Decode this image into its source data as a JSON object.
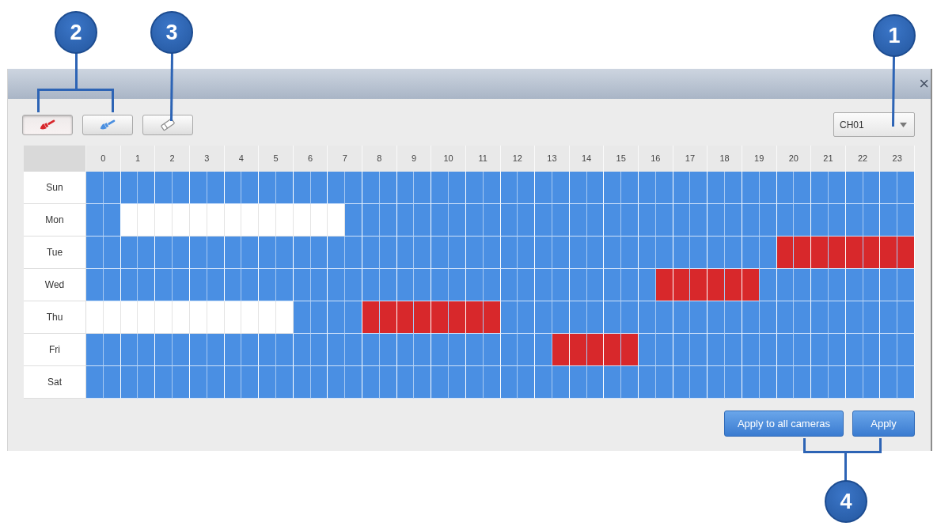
{
  "callouts": [
    {
      "label": "2"
    },
    {
      "label": "3"
    },
    {
      "label": "1"
    },
    {
      "label": "4"
    }
  ],
  "dialog": {
    "close": "×",
    "tools": [
      {
        "kind": "brush",
        "color": "#d8262b",
        "selected": true
      },
      {
        "kind": "brush",
        "color": "#4a8fe0",
        "selected": false
      },
      {
        "kind": "eraser",
        "selected": false
      }
    ],
    "channel": {
      "value": "CH01"
    },
    "schedule": {
      "hours": [
        "0",
        "1",
        "2",
        "3",
        "4",
        "5",
        "6",
        "7",
        "8",
        "9",
        "10",
        "11",
        "12",
        "13",
        "14",
        "15",
        "16",
        "17",
        "18",
        "19",
        "20",
        "21",
        "22",
        "23"
      ],
      "days": [
        {
          "label": "Sun",
          "slots": [
            {
              "kind": "normal"
            },
            {
              "kind": "normal"
            },
            {
              "kind": "normal"
            },
            {
              "kind": "normal"
            },
            {
              "kind": "normal"
            },
            {
              "kind": "normal"
            },
            {
              "kind": "normal"
            },
            {
              "kind": "normal"
            },
            {
              "kind": "normal"
            },
            {
              "kind": "normal"
            },
            {
              "kind": "normal"
            },
            {
              "kind": "normal"
            },
            {
              "kind": "normal"
            },
            {
              "kind": "normal"
            },
            {
              "kind": "normal"
            },
            {
              "kind": "normal"
            },
            {
              "kind": "normal"
            },
            {
              "kind": "normal"
            },
            {
              "kind": "normal"
            },
            {
              "kind": "normal"
            },
            {
              "kind": "normal"
            },
            {
              "kind": "normal"
            },
            {
              "kind": "normal"
            },
            {
              "kind": "normal"
            },
            {
              "kind": "normal"
            },
            {
              "kind": "normal"
            },
            {
              "kind": "normal"
            },
            {
              "kind": "normal"
            },
            {
              "kind": "normal"
            },
            {
              "kind": "normal"
            },
            {
              "kind": "normal"
            },
            {
              "kind": "normal"
            },
            {
              "kind": "normal"
            },
            {
              "kind": "normal"
            },
            {
              "kind": "normal"
            },
            {
              "kind": "normal"
            },
            {
              "kind": "normal"
            },
            {
              "kind": "normal"
            },
            {
              "kind": "normal"
            },
            {
              "kind": "normal"
            },
            {
              "kind": "normal"
            },
            {
              "kind": "normal"
            },
            {
              "kind": "normal"
            },
            {
              "kind": "normal"
            },
            {
              "kind": "normal"
            },
            {
              "kind": "normal"
            },
            {
              "kind": "normal"
            },
            {
              "kind": "normal"
            }
          ]
        },
        {
          "label": "Mon",
          "slots": [
            {
              "kind": "normal"
            },
            {
              "kind": "normal"
            },
            {
              "kind": "empty"
            },
            {
              "kind": "empty"
            },
            {
              "kind": "empty"
            },
            {
              "kind": "empty"
            },
            {
              "kind": "empty"
            },
            {
              "kind": "empty"
            },
            {
              "kind": "empty"
            },
            {
              "kind": "empty"
            },
            {
              "kind": "empty"
            },
            {
              "kind": "empty"
            },
            {
              "kind": "empty"
            },
            {
              "kind": "empty"
            },
            {
              "kind": "empty"
            },
            {
              "kind": "normal"
            },
            {
              "kind": "normal"
            },
            {
              "kind": "normal"
            },
            {
              "kind": "normal"
            },
            {
              "kind": "normal"
            },
            {
              "kind": "normal"
            },
            {
              "kind": "normal"
            },
            {
              "kind": "normal"
            },
            {
              "kind": "normal"
            },
            {
              "kind": "normal"
            },
            {
              "kind": "normal"
            },
            {
              "kind": "normal"
            },
            {
              "kind": "normal"
            },
            {
              "kind": "normal"
            },
            {
              "kind": "normal"
            },
            {
              "kind": "normal"
            },
            {
              "kind": "normal"
            },
            {
              "kind": "normal"
            },
            {
              "kind": "normal"
            },
            {
              "kind": "normal"
            },
            {
              "kind": "normal"
            },
            {
              "kind": "normal"
            },
            {
              "kind": "normal"
            },
            {
              "kind": "normal"
            },
            {
              "kind": "normal"
            },
            {
              "kind": "normal"
            },
            {
              "kind": "normal"
            },
            {
              "kind": "normal"
            },
            {
              "kind": "normal"
            },
            {
              "kind": "normal"
            },
            {
              "kind": "normal"
            },
            {
              "kind": "normal"
            },
            {
              "kind": "normal"
            }
          ]
        },
        {
          "label": "Tue",
          "slots": [
            {
              "kind": "normal"
            },
            {
              "kind": "normal"
            },
            {
              "kind": "normal"
            },
            {
              "kind": "normal"
            },
            {
              "kind": "normal"
            },
            {
              "kind": "normal"
            },
            {
              "kind": "normal"
            },
            {
              "kind": "normal"
            },
            {
              "kind": "normal"
            },
            {
              "kind": "normal"
            },
            {
              "kind": "normal"
            },
            {
              "kind": "normal"
            },
            {
              "kind": "normal"
            },
            {
              "kind": "normal"
            },
            {
              "kind": "normal"
            },
            {
              "kind": "normal"
            },
            {
              "kind": "normal"
            },
            {
              "kind": "normal"
            },
            {
              "kind": "normal"
            },
            {
              "kind": "normal"
            },
            {
              "kind": "normal"
            },
            {
              "kind": "normal"
            },
            {
              "kind": "normal"
            },
            {
              "kind": "normal"
            },
            {
              "kind": "normal"
            },
            {
              "kind": "normal"
            },
            {
              "kind": "normal"
            },
            {
              "kind": "normal"
            },
            {
              "kind": "normal"
            },
            {
              "kind": "normal"
            },
            {
              "kind": "normal"
            },
            {
              "kind": "normal"
            },
            {
              "kind": "normal"
            },
            {
              "kind": "normal"
            },
            {
              "kind": "normal"
            },
            {
              "kind": "normal"
            },
            {
              "kind": "normal"
            },
            {
              "kind": "normal"
            },
            {
              "kind": "normal"
            },
            {
              "kind": "normal"
            },
            {
              "kind": "alarm"
            },
            {
              "kind": "alarm"
            },
            {
              "kind": "alarm"
            },
            {
              "kind": "alarm"
            },
            {
              "kind": "alarm"
            },
            {
              "kind": "alarm"
            },
            {
              "kind": "alarm"
            },
            {
              "kind": "alarm"
            }
          ]
        },
        {
          "label": "Wed",
          "slots": [
            {
              "kind": "normal"
            },
            {
              "kind": "normal"
            },
            {
              "kind": "normal"
            },
            {
              "kind": "normal"
            },
            {
              "kind": "normal"
            },
            {
              "kind": "normal"
            },
            {
              "kind": "normal"
            },
            {
              "kind": "normal"
            },
            {
              "kind": "normal"
            },
            {
              "kind": "normal"
            },
            {
              "kind": "normal"
            },
            {
              "kind": "normal"
            },
            {
              "kind": "normal"
            },
            {
              "kind": "normal"
            },
            {
              "kind": "normal"
            },
            {
              "kind": "normal"
            },
            {
              "kind": "normal"
            },
            {
              "kind": "normal"
            },
            {
              "kind": "normal"
            },
            {
              "kind": "normal"
            },
            {
              "kind": "normal"
            },
            {
              "kind": "normal"
            },
            {
              "kind": "normal"
            },
            {
              "kind": "normal"
            },
            {
              "kind": "normal"
            },
            {
              "kind": "normal"
            },
            {
              "kind": "normal"
            },
            {
              "kind": "normal"
            },
            {
              "kind": "normal"
            },
            {
              "kind": "normal"
            },
            {
              "kind": "normal"
            },
            {
              "kind": "normal"
            },
            {
              "kind": "normal"
            },
            {
              "kind": "alarm"
            },
            {
              "kind": "alarm"
            },
            {
              "kind": "alarm"
            },
            {
              "kind": "alarm"
            },
            {
              "kind": "alarm"
            },
            {
              "kind": "alarm"
            },
            {
              "kind": "normal"
            },
            {
              "kind": "normal"
            },
            {
              "kind": "normal"
            },
            {
              "kind": "normal"
            },
            {
              "kind": "normal"
            },
            {
              "kind": "normal"
            },
            {
              "kind": "normal"
            },
            {
              "kind": "normal"
            },
            {
              "kind": "normal"
            }
          ]
        },
        {
          "label": "Thu",
          "slots": [
            {
              "kind": "empty"
            },
            {
              "kind": "empty"
            },
            {
              "kind": "empty"
            },
            {
              "kind": "empty"
            },
            {
              "kind": "empty"
            },
            {
              "kind": "empty"
            },
            {
              "kind": "empty"
            },
            {
              "kind": "empty"
            },
            {
              "kind": "empty"
            },
            {
              "kind": "empty"
            },
            {
              "kind": "empty"
            },
            {
              "kind": "empty"
            },
            {
              "kind": "normal"
            },
            {
              "kind": "normal"
            },
            {
              "kind": "normal"
            },
            {
              "kind": "normal"
            },
            {
              "kind": "alarm"
            },
            {
              "kind": "alarm"
            },
            {
              "kind": "alarm"
            },
            {
              "kind": "alarm"
            },
            {
              "kind": "alarm"
            },
            {
              "kind": "alarm"
            },
            {
              "kind": "alarm"
            },
            {
              "kind": "alarm"
            },
            {
              "kind": "normal"
            },
            {
              "kind": "normal"
            },
            {
              "kind": "normal"
            },
            {
              "kind": "normal"
            },
            {
              "kind": "normal"
            },
            {
              "kind": "normal"
            },
            {
              "kind": "normal"
            },
            {
              "kind": "normal"
            },
            {
              "kind": "normal"
            },
            {
              "kind": "normal"
            },
            {
              "kind": "normal"
            },
            {
              "kind": "normal"
            },
            {
              "kind": "normal"
            },
            {
              "kind": "normal"
            },
            {
              "kind": "normal"
            },
            {
              "kind": "normal"
            },
            {
              "kind": "normal"
            },
            {
              "kind": "normal"
            },
            {
              "kind": "normal"
            },
            {
              "kind": "normal"
            },
            {
              "kind": "normal"
            },
            {
              "kind": "normal"
            },
            {
              "kind": "normal"
            },
            {
              "kind": "normal"
            }
          ]
        },
        {
          "label": "Fri",
          "slots": [
            {
              "kind": "normal"
            },
            {
              "kind": "normal"
            },
            {
              "kind": "normal"
            },
            {
              "kind": "normal"
            },
            {
              "kind": "normal"
            },
            {
              "kind": "normal"
            },
            {
              "kind": "normal"
            },
            {
              "kind": "normal"
            },
            {
              "kind": "normal"
            },
            {
              "kind": "normal"
            },
            {
              "kind": "normal"
            },
            {
              "kind": "normal"
            },
            {
              "kind": "normal"
            },
            {
              "kind": "normal"
            },
            {
              "kind": "normal"
            },
            {
              "kind": "normal"
            },
            {
              "kind": "normal"
            },
            {
              "kind": "normal"
            },
            {
              "kind": "normal"
            },
            {
              "kind": "normal"
            },
            {
              "kind": "normal"
            },
            {
              "kind": "normal"
            },
            {
              "kind": "normal"
            },
            {
              "kind": "normal"
            },
            {
              "kind": "normal"
            },
            {
              "kind": "normal"
            },
            {
              "kind": "normal"
            },
            {
              "kind": "alarm"
            },
            {
              "kind": "alarm"
            },
            {
              "kind": "alarm"
            },
            {
              "kind": "alarm"
            },
            {
              "kind": "alarm"
            },
            {
              "kind": "normal"
            },
            {
              "kind": "normal"
            },
            {
              "kind": "normal"
            },
            {
              "kind": "normal"
            },
            {
              "kind": "normal"
            },
            {
              "kind": "normal"
            },
            {
              "kind": "normal"
            },
            {
              "kind": "normal"
            },
            {
              "kind": "normal"
            },
            {
              "kind": "normal"
            },
            {
              "kind": "normal"
            },
            {
              "kind": "normal"
            },
            {
              "kind": "normal"
            },
            {
              "kind": "normal"
            },
            {
              "kind": "normal"
            },
            {
              "kind": "normal"
            }
          ]
        },
        {
          "label": "Sat",
          "slots": [
            {
              "kind": "normal"
            },
            {
              "kind": "normal"
            },
            {
              "kind": "normal"
            },
            {
              "kind": "normal"
            },
            {
              "kind": "normal"
            },
            {
              "kind": "normal"
            },
            {
              "kind": "normal"
            },
            {
              "kind": "normal"
            },
            {
              "kind": "normal"
            },
            {
              "kind": "normal"
            },
            {
              "kind": "normal"
            },
            {
              "kind": "normal"
            },
            {
              "kind": "normal"
            },
            {
              "kind": "normal"
            },
            {
              "kind": "normal"
            },
            {
              "kind": "normal"
            },
            {
              "kind": "normal"
            },
            {
              "kind": "normal"
            },
            {
              "kind": "normal"
            },
            {
              "kind": "normal"
            },
            {
              "kind": "normal"
            },
            {
              "kind": "normal"
            },
            {
              "kind": "normal"
            },
            {
              "kind": "normal"
            },
            {
              "kind": "normal"
            },
            {
              "kind": "normal"
            },
            {
              "kind": "normal"
            },
            {
              "kind": "normal"
            },
            {
              "kind": "normal"
            },
            {
              "kind": "normal"
            },
            {
              "kind": "normal"
            },
            {
              "kind": "normal"
            },
            {
              "kind": "normal"
            },
            {
              "kind": "normal"
            },
            {
              "kind": "normal"
            },
            {
              "kind": "normal"
            },
            {
              "kind": "normal"
            },
            {
              "kind": "normal"
            },
            {
              "kind": "normal"
            },
            {
              "kind": "normal"
            },
            {
              "kind": "normal"
            },
            {
              "kind": "normal"
            },
            {
              "kind": "normal"
            },
            {
              "kind": "normal"
            },
            {
              "kind": "normal"
            },
            {
              "kind": "normal"
            },
            {
              "kind": "normal"
            },
            {
              "kind": "normal"
            }
          ]
        }
      ]
    },
    "buttons": [
      "Apply to all cameras",
      "Apply"
    ]
  }
}
